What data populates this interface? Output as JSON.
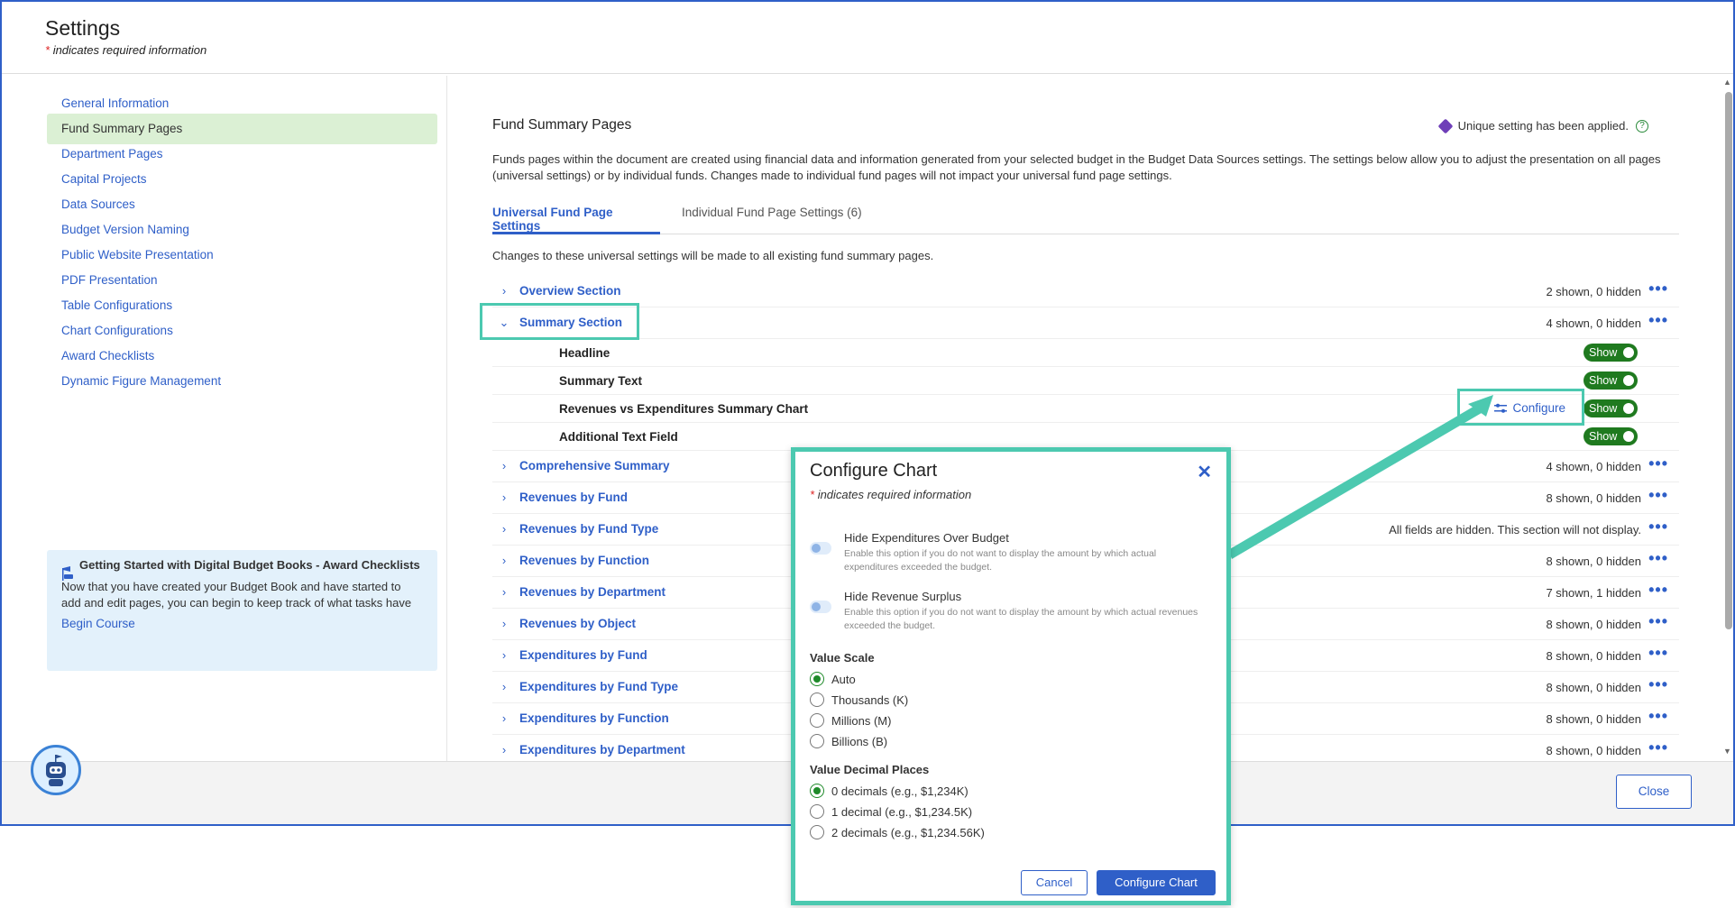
{
  "header": {
    "title": "Settings",
    "required_star": "*",
    "required_note": "indicates required information"
  },
  "sidebar": {
    "items": [
      {
        "label": "General Information"
      },
      {
        "label": "Fund Summary Pages"
      },
      {
        "label": "Department Pages"
      },
      {
        "label": "Capital Projects"
      },
      {
        "label": "Data Sources"
      },
      {
        "label": "Budget Version Naming"
      },
      {
        "label": "Public Website Presentation"
      },
      {
        "label": "PDF Presentation"
      },
      {
        "label": "Table Configurations"
      },
      {
        "label": "Chart Configurations"
      },
      {
        "label": "Award Checklists"
      },
      {
        "label": "Dynamic Figure Management"
      }
    ],
    "course": {
      "title": "Getting Started with Digital Budget Books - Award Checklists",
      "body": "Now that you have created your Budget Book and have started to add and edit pages, you can begin to keep track of what tasks have",
      "link": "Begin Course"
    }
  },
  "main": {
    "title": "Fund Summary Pages",
    "unique_note": "Unique setting has been applied.",
    "help": "?",
    "description": "Funds pages within the document are created using financial data and information generated from your selected budget in the Budget Data Sources settings. The settings below allow you to adjust the presentation on all pages (universal settings) or by individual funds. Changes made to individual fund pages will not impact your universal fund page settings.",
    "tabs": [
      {
        "label": "Universal Fund Page Settings"
      },
      {
        "label": "Individual Fund Page Settings (6)"
      }
    ],
    "note": "Changes to these universal settings will be made to all existing fund summary pages.",
    "more": "•••",
    "sections": [
      {
        "label": "Overview Section",
        "count": "2 shown, 0 hidden",
        "chev": "›"
      },
      {
        "label": "Summary Section",
        "count": "4 shown, 0 hidden",
        "chev": "⌄"
      },
      {
        "label": "Comprehensive Summary",
        "count": "4 shown, 0 hidden",
        "chev": "›"
      },
      {
        "label": "Revenues by Fund",
        "count": "8 shown, 0 hidden",
        "chev": "›"
      },
      {
        "label": "Revenues by Fund Type",
        "count": "All fields are hidden. This section will not display.",
        "chev": "›"
      },
      {
        "label": "Revenues by Function",
        "count": "8 shown, 0 hidden",
        "chev": "›"
      },
      {
        "label": "Revenues by Department",
        "count": "7 shown, 1 hidden",
        "chev": "›"
      },
      {
        "label": "Revenues by Object",
        "count": "8 shown, 0 hidden",
        "chev": "›"
      },
      {
        "label": "Expenditures by Fund",
        "count": "8 shown, 0 hidden",
        "chev": "›"
      },
      {
        "label": "Expenditures by Fund Type",
        "count": "8 shown, 0 hidden",
        "chev": "›"
      },
      {
        "label": "Expenditures by Function",
        "count": "8 shown, 0 hidden",
        "chev": "›"
      },
      {
        "label": "Expenditures by Department",
        "count": "8 shown, 0 hidden",
        "chev": "›"
      }
    ],
    "summary_items": [
      {
        "label": "Headline",
        "toggle": "Show"
      },
      {
        "label": "Summary Text",
        "toggle": "Show"
      },
      {
        "label": "Revenues vs Expenditures Summary Chart",
        "toggle": "Show",
        "configure": "Configure"
      },
      {
        "label": "Additional Text Field",
        "toggle": "Show"
      }
    ]
  },
  "footer": {
    "close": "Close"
  },
  "modal": {
    "title": "Configure Chart",
    "required_star": "*",
    "required_note": "indicates required information",
    "close": "✕",
    "options": [
      {
        "title": "Hide Expenditures Over Budget",
        "desc": "Enable this option if you do not want to display the amount by which actual expenditures exceeded the budget."
      },
      {
        "title": "Hide Revenue Surplus",
        "desc": "Enable this option if you do not want to display the amount by which actual revenues exceeded the budget."
      }
    ],
    "value_scale": {
      "label": "Value Scale",
      "options": [
        "Auto",
        "Thousands (K)",
        "Millions (M)",
        "Billions (B)"
      ],
      "selected": "Auto"
    },
    "decimals": {
      "label": "Value Decimal Places",
      "options": [
        "0 decimals (e.g., $1,234K)",
        "1 decimal (e.g., $1,234.5K)",
        "2 decimals (e.g., $1,234.56K)"
      ],
      "selected": "0 decimals (e.g., $1,234K)"
    },
    "cancel": "Cancel",
    "confirm": "Configure Chart"
  },
  "colors": {
    "accent": "#2f5fc8",
    "highlight": "#4cc9b0",
    "toggle_on": "#1f7a1f",
    "active_nav": "#dbf0d4"
  }
}
